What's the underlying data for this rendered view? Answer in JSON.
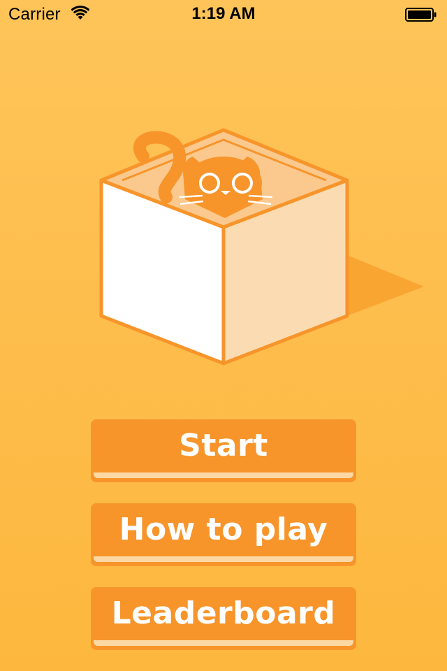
{
  "status_bar": {
    "carrier": "Carrier",
    "time": "1:19 AM",
    "wifi_icon": "wifi-icon",
    "battery_icon": "battery-icon"
  },
  "illustration": {
    "subject": "cat-in-box",
    "colors": {
      "orange": "#f7952b",
      "box_face_light": "#ffffff",
      "box_face_shaded": "#fbdcb2",
      "box_inside": "#fbc98d",
      "shadow": "#f9a532"
    }
  },
  "menu": {
    "start_label": "Start",
    "how_to_play_label": "How to play",
    "leaderboard_label": "Leaderboard"
  },
  "theme": {
    "background_top": "#fec459",
    "background_bottom": "#fdb73e",
    "button_color": "#f7952b",
    "button_text": "#ffffff"
  }
}
